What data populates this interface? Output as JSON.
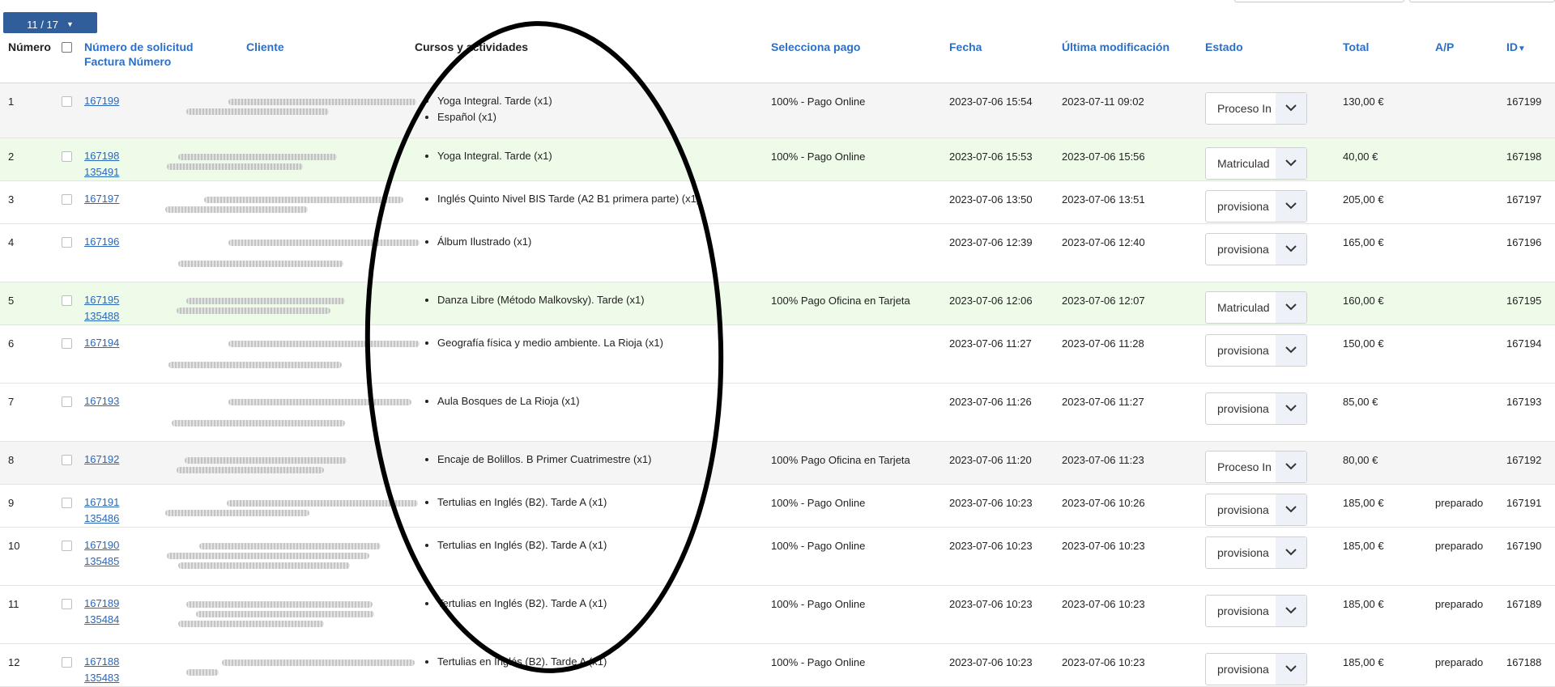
{
  "pager": {
    "label": "11 / 17"
  },
  "table": {
    "headers": {
      "numero": "Número",
      "solicitud": "Número de solicitud",
      "factura": "Factura Número",
      "cliente": "Cliente",
      "cursos": "Cursos y actividades",
      "pago": "Selecciona pago",
      "fecha": "Fecha",
      "modificacion": "Última modificación",
      "estado": "Estado",
      "total": "Total",
      "ap": "A/P",
      "id": "ID"
    },
    "rows": [
      {
        "num": "1",
        "solicitud": "167199",
        "factura": "",
        "courses": [
          "Yoga Integral. Tarde (x1)",
          "Español (x1)"
        ],
        "pago": "100% - Pago Online",
        "fecha": "2023-07-06 15:54",
        "mod": "2023-07-11 09:02",
        "estado": "Proceso In",
        "total": "130,00 €",
        "ap": "",
        "id": "167199",
        "tone": "gray"
      },
      {
        "num": "2",
        "solicitud": "167198",
        "factura": "135491",
        "courses": [
          "Yoga Integral. Tarde (x1)"
        ],
        "pago": "100% - Pago Online",
        "fecha": "2023-07-06 15:53",
        "mod": "2023-07-06 15:56",
        "estado": "Matriculad",
        "total": "40,00 €",
        "ap": "",
        "id": "167198",
        "tone": "green"
      },
      {
        "num": "3",
        "solicitud": "167197",
        "factura": "",
        "courses": [
          "Inglés Quinto Nivel BIS Tarde (A2 B1 primera parte) (x1)"
        ],
        "pago": "",
        "fecha": "2023-07-06 13:50",
        "mod": "2023-07-06 13:51",
        "estado": "provisiona",
        "total": "205,00 €",
        "ap": "",
        "id": "167197",
        "tone": "white"
      },
      {
        "num": "4",
        "solicitud": "167196",
        "factura": "",
        "courses": [
          "Álbum Ilustrado (x1)"
        ],
        "pago": "",
        "fecha": "2023-07-06 12:39",
        "mod": "2023-07-06 12:40",
        "estado": "provisiona",
        "total": "165,00 €",
        "ap": "",
        "id": "167196",
        "tone": "white"
      },
      {
        "num": "5",
        "solicitud": "167195",
        "factura": "135488",
        "courses": [
          "Danza Libre (Método Malkovsky). Tarde (x1)"
        ],
        "pago": "100% Pago Oficina en Tarjeta",
        "fecha": "2023-07-06 12:06",
        "mod": "2023-07-06 12:07",
        "estado": "Matriculad",
        "total": "160,00 €",
        "ap": "",
        "id": "167195",
        "tone": "green"
      },
      {
        "num": "6",
        "solicitud": "167194",
        "factura": "",
        "courses": [
          "Geografía física y medio ambiente. La Rioja (x1)"
        ],
        "pago": "",
        "fecha": "2023-07-06 11:27",
        "mod": "2023-07-06 11:28",
        "estado": "provisiona",
        "total": "150,00 €",
        "ap": "",
        "id": "167194",
        "tone": "white"
      },
      {
        "num": "7",
        "solicitud": "167193",
        "factura": "",
        "courses": [
          "Aula Bosques de La Rioja (x1)"
        ],
        "pago": "",
        "fecha": "2023-07-06 11:26",
        "mod": "2023-07-06 11:27",
        "estado": "provisiona",
        "total": "85,00 €",
        "ap": "",
        "id": "167193",
        "tone": "white"
      },
      {
        "num": "8",
        "solicitud": "167192",
        "factura": "",
        "courses": [
          "Encaje de Bolillos. B Primer Cuatrimestre (x1)"
        ],
        "pago": "100% Pago Oficina en Tarjeta",
        "fecha": "2023-07-06 11:20",
        "mod": "2023-07-06 11:23",
        "estado": "Proceso In",
        "total": "80,00 €",
        "ap": "",
        "id": "167192",
        "tone": "gray"
      },
      {
        "num": "9",
        "solicitud": "167191",
        "factura": "135486",
        "courses": [
          "Tertulias en Inglés (B2). Tarde A (x1)"
        ],
        "pago": "100% - Pago Online",
        "fecha": "2023-07-06 10:23",
        "mod": "2023-07-06 10:26",
        "estado": "provisiona",
        "total": "185,00 €",
        "ap": "preparado",
        "id": "167191",
        "tone": "white"
      },
      {
        "num": "10",
        "solicitud": "167190",
        "factura": "135485",
        "courses": [
          "Tertulias en Inglés (B2). Tarde A (x1)"
        ],
        "pago": "100% - Pago Online",
        "fecha": "2023-07-06 10:23",
        "mod": "2023-07-06 10:23",
        "estado": "provisiona",
        "total": "185,00 €",
        "ap": "preparado",
        "id": "167190",
        "tone": "white"
      },
      {
        "num": "11",
        "solicitud": "167189",
        "factura": "135484",
        "courses": [
          "Tertulias en Inglés (B2). Tarde A (x1)"
        ],
        "pago": "100% - Pago Online",
        "fecha": "2023-07-06 10:23",
        "mod": "2023-07-06 10:23",
        "estado": "provisiona",
        "total": "185,00 €",
        "ap": "preparado",
        "id": "167189",
        "tone": "white"
      },
      {
        "num": "12",
        "solicitud": "167188",
        "factura": "135483",
        "courses": [
          "Tertulias en Inglés (B2). Tarde A (x1)"
        ],
        "pago": "100% - Pago Online",
        "fecha": "2023-07-06 10:23",
        "mod": "2023-07-06 10:23",
        "estado": "provisiona",
        "total": "185,00 €",
        "ap": "preparado",
        "id": "167188",
        "tone": "white"
      }
    ]
  },
  "icons": {
    "sort": "caret-down-icon",
    "dropdown": "chevron-down-icon"
  }
}
